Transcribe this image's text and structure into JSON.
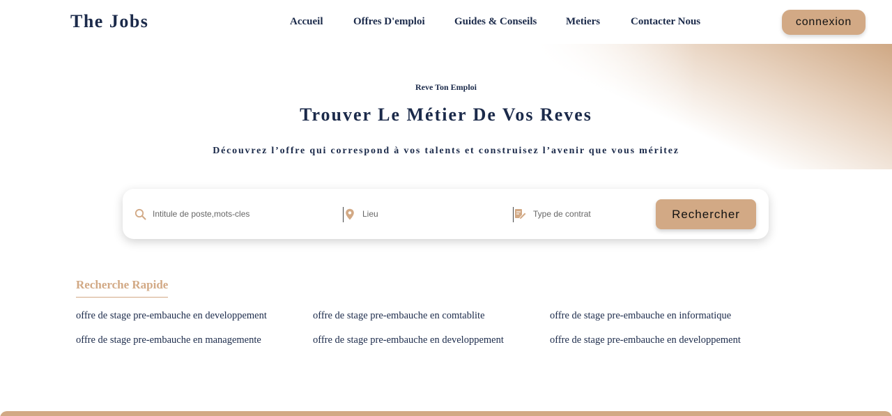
{
  "header": {
    "logo": "The Jobs",
    "nav": [
      "Accueil",
      "Offres D'emploi",
      "Guides & Conseils",
      "Metiers",
      "Contacter Nous"
    ],
    "login_label": "connexion"
  },
  "hero": {
    "kicker": "Reve Ton Emploi",
    "title": "Trouver Le Métier De Vos Reves",
    "subtitle": "Découvrez l’offre qui correspond à vos talents et construisez l’avenir que vous méritez"
  },
  "search": {
    "keywords_placeholder": "Intitule de poste,mots-cles",
    "location_placeholder": "Lieu",
    "contract_placeholder": "Type de contrat",
    "button_label": "Rechercher",
    "icons": [
      "search-icon",
      "location-pin-icon",
      "contract-sign-icon"
    ]
  },
  "quick_search": {
    "title": "Recherche Rapide",
    "links": [
      "offre de stage pre-embauche en developpement",
      "offre de stage pre-embauche en comtablite",
      "offre de stage pre-embauche en informatique",
      "offre de stage pre-embauche en managemente",
      "offre de stage pre-embauche en developpement",
      "offre de stage pre-embauche en developpement"
    ]
  },
  "colors": {
    "accent": "#d2a985",
    "navy": "#1b2a4a",
    "background": "#ffffff"
  }
}
